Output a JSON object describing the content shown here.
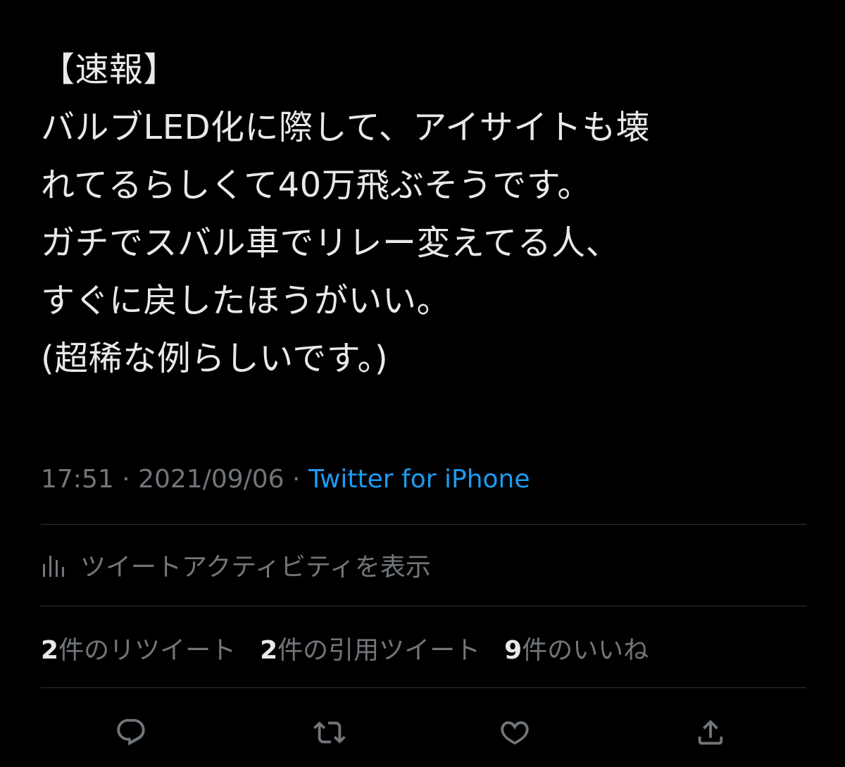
{
  "tweet": {
    "lines": [
      "【速報】",
      "バルブLED化に際して、アイサイトも壊",
      "れてるらしくて40万飛ぶそうです。",
      "ガチでスバル車でリレー変えてる人、",
      "すぐに戻したほうがいい。",
      "(超稀な例らしいです。)"
    ]
  },
  "meta": {
    "time": "17:51",
    "separator": " · ",
    "date": "2021/09/06",
    "source": "Twitter for iPhone"
  },
  "activity": {
    "label": "ツイートアクティビティを表示",
    "icon": "bar-chart-icon"
  },
  "stats": {
    "retweets_count": "2",
    "retweets_label": "件のリツイート",
    "quotes_count": "2",
    "quotes_label": "件の引用ツイート",
    "likes_count": "9",
    "likes_label": "件のいいね"
  },
  "actions": [
    {
      "name": "reply",
      "icon": "reply-icon"
    },
    {
      "name": "retweet",
      "icon": "retweet-icon"
    },
    {
      "name": "like",
      "icon": "heart-icon"
    },
    {
      "name": "share",
      "icon": "share-icon"
    }
  ],
  "colors": {
    "background": "#000000",
    "text": "#e7e9ea",
    "muted": "#71767b",
    "link": "#1d9bf0",
    "divider": "#2f3336"
  }
}
